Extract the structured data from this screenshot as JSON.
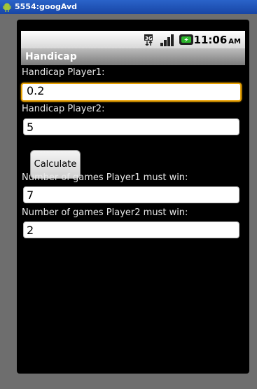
{
  "window": {
    "title": "5554:googAvd"
  },
  "status_bar": {
    "network_icon": "3g-data-icon",
    "signal_icon": "signal-strength-icon",
    "battery_icon": "battery-charging-icon",
    "time": "11:06",
    "ampm": "AM"
  },
  "app": {
    "title": "Handicap"
  },
  "form": {
    "player1_label": "Handicap Player1:",
    "player1_value": "0.2",
    "player2_label": "Handicap Player2:",
    "player2_value": "5",
    "calculate_label": "Calculate",
    "result1_label": "Number of games Player1 must win:",
    "result1_value": "7",
    "result2_label": "Number of games Player2 must win:",
    "result2_value": "2"
  },
  "colors": {
    "focus_border": "#e8a000",
    "window_title_bg": "#1846a6",
    "app_title_bg": "#9a9a9a"
  }
}
